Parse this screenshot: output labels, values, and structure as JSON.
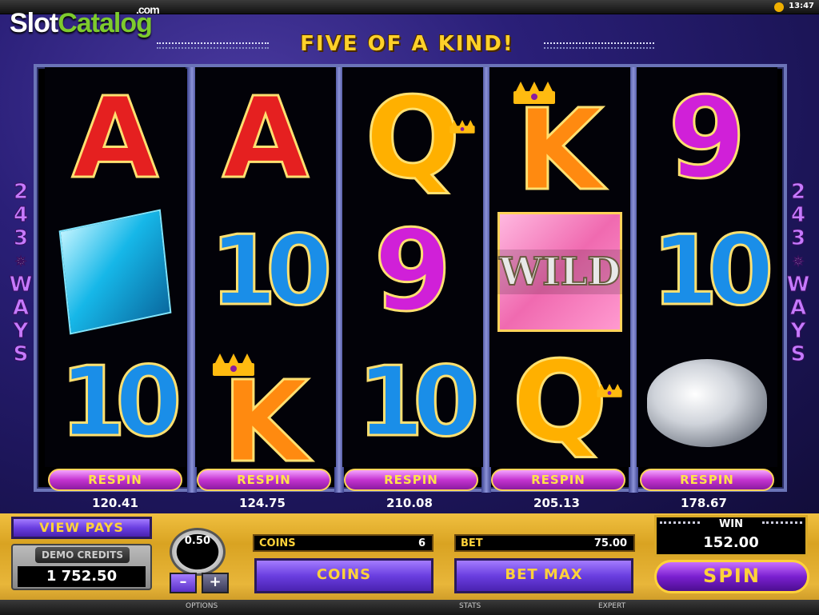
{
  "status_bar": {
    "clock": "13:47"
  },
  "logo": {
    "part1": "Slot",
    "part2": "Catalog",
    "suffix": ".com"
  },
  "headline": "FIVE OF A KIND!",
  "ways": {
    "left": [
      "2",
      "4",
      "3",
      "✵",
      "W",
      "A",
      "Y",
      "S"
    ],
    "right": [
      "2",
      "4",
      "3",
      "✵",
      "W",
      "A",
      "Y",
      "S"
    ]
  },
  "reels": [
    {
      "symbols": [
        "A",
        "diamond-blue",
        "10"
      ],
      "respin_label": "RESPIN",
      "value": "120.41"
    },
    {
      "symbols": [
        "A",
        "10",
        "K"
      ],
      "respin_label": "RESPIN",
      "value": "124.75"
    },
    {
      "symbols": [
        "Q",
        "9",
        "10"
      ],
      "respin_label": "RESPIN",
      "value": "210.08"
    },
    {
      "symbols": [
        "K",
        "WILD",
        "Q"
      ],
      "respin_label": "RESPIN",
      "value": "205.13"
    },
    {
      "symbols": [
        "9",
        "10",
        "diamond-white"
      ],
      "respin_label": "RESPIN",
      "value": "178.67"
    }
  ],
  "symbol_text": {
    "wild": "WILD"
  },
  "panel": {
    "view_pays": "VIEW PAYS",
    "demo_credits_label": "DEMO CREDITS",
    "demo_credits_value": "1 752.50",
    "coin_size": "0.50",
    "minus": "–",
    "plus": "+",
    "coins_label": "COINS",
    "coins_value": "6",
    "bet_label": "BET",
    "bet_value": "75.00",
    "coins_button": "COINS",
    "bet_max_button": "BET MAX",
    "win_label": "WIN",
    "win_value": "152.00",
    "spin_button": "SPIN"
  },
  "bottom_bar": {
    "options": "OPTIONS",
    "stats": "STATS",
    "expert": "EXPERT"
  },
  "colors": {
    "letter_a": "#e52020",
    "letter_k": "#ff8a10",
    "letter_q": "#ffb000",
    "nine": "#d020d8",
    "ten": "#1a8ee8",
    "panel_gold": "#d9a322",
    "button_purple": "#6a3ee0"
  }
}
